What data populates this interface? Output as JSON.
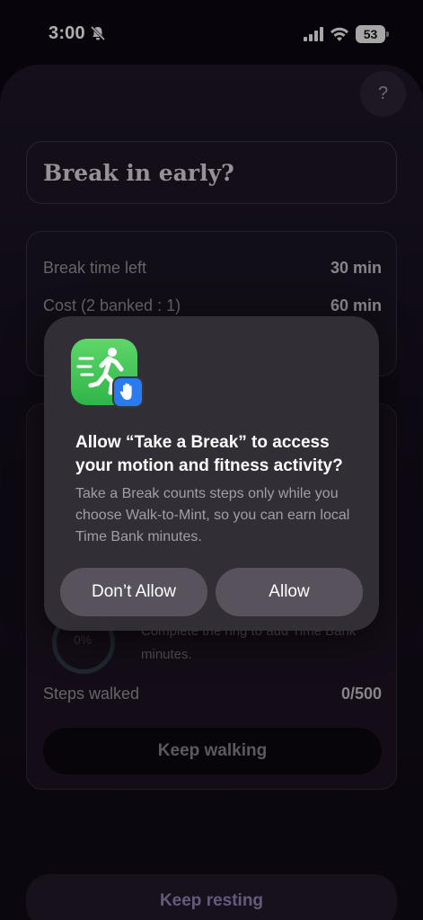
{
  "status_bar": {
    "time": "3:00",
    "battery": "53"
  },
  "help": {
    "label": "?"
  },
  "header": {
    "title": "Break in early?"
  },
  "info": {
    "rows": [
      {
        "label": "Break time left",
        "value": "30 min"
      },
      {
        "label": "Cost (2 banked : 1)",
        "value": "60 min"
      }
    ]
  },
  "walk": {
    "ring_value": "0%",
    "hint": "Complete the ring to add Time Bank minutes.",
    "steps_label": "Steps walked",
    "steps_value": "0/500",
    "keep_walking": "Keep walking"
  },
  "footer": {
    "keep_resting": "Keep resting"
  },
  "alert": {
    "title": "Allow “Take a Break” to access your motion and fitness activity?",
    "body": "Take a Break counts steps only while you choose Walk-to-Mint, so you can earn local Time Bank minutes.",
    "deny_label": "Don’t Allow",
    "allow_label": "Allow",
    "icon_color": "#34c759",
    "badge_color": "#2a7bf0"
  }
}
